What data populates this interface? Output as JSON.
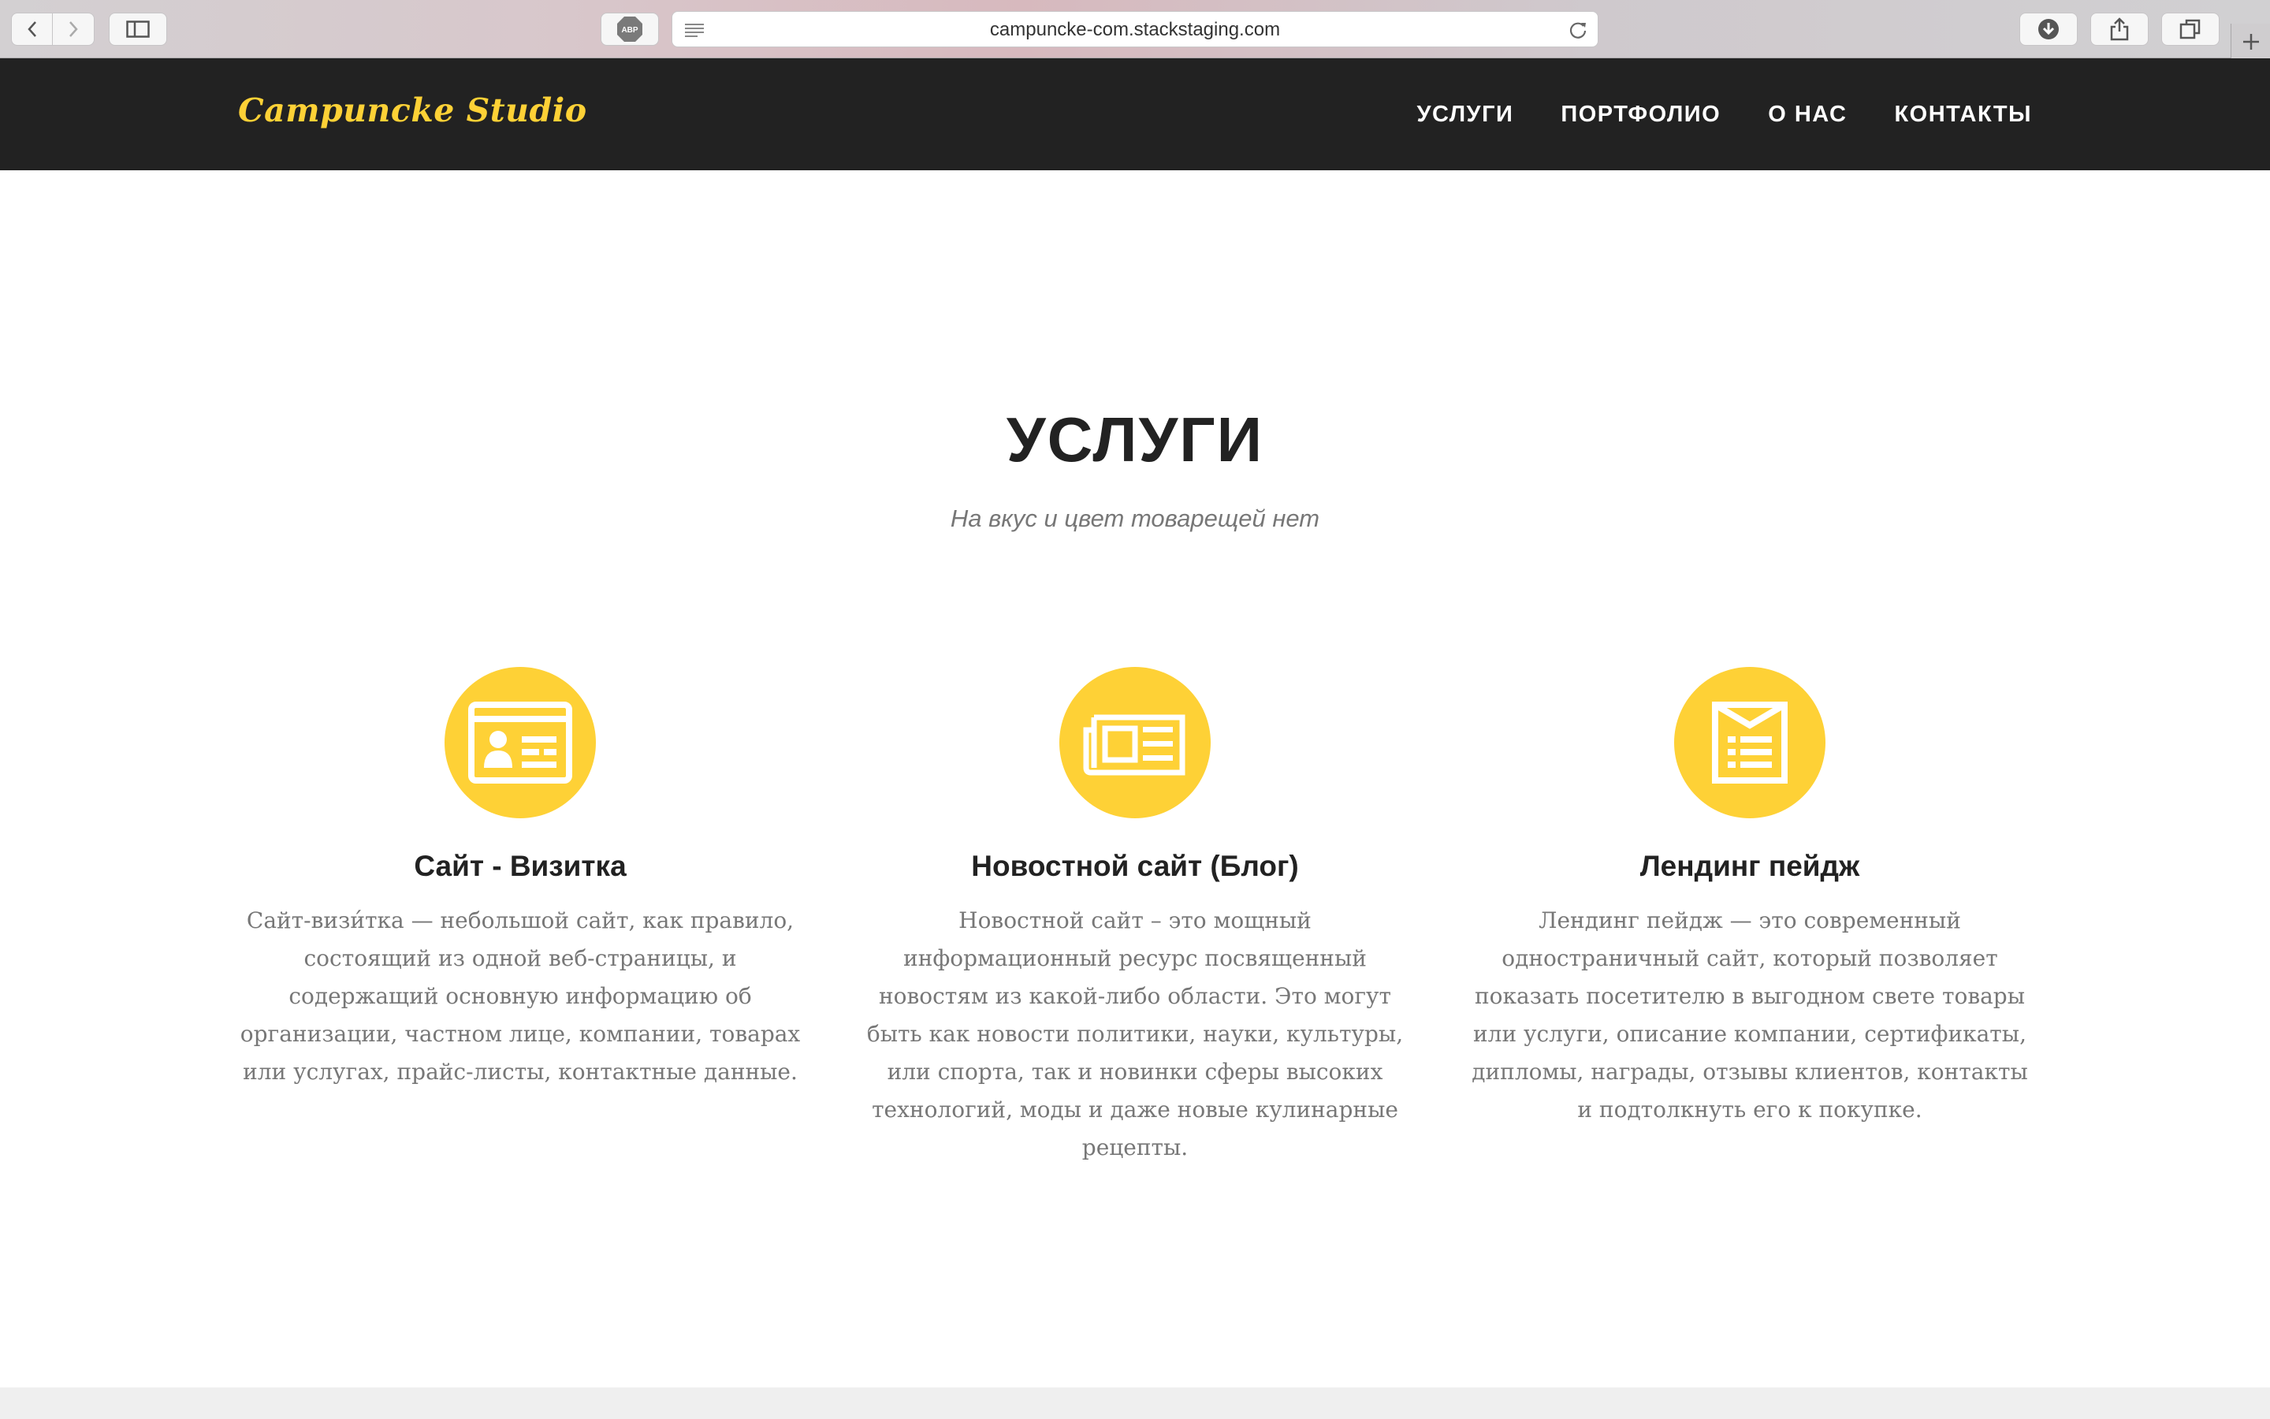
{
  "browser": {
    "url": "campuncke-com.stackstaging.com",
    "adblock_label": "ABP"
  },
  "site": {
    "logo": "Campuncke Studio",
    "menu": [
      "УСЛУГИ",
      "ПОРТФОЛИО",
      "О НАС",
      "КОНТАКТЫ"
    ]
  },
  "services": {
    "heading": "УСЛУГИ",
    "subheading": "На вкус и цвет товарещей нет",
    "items": [
      {
        "icon": "id-card-icon",
        "title": "Сайт - Визитка",
        "text": "Сайт-визи́тка — небольшой сайт, как правило, состоящий из одной веб-страницы, и содержащий основную информацию об организации, частном лице, компании, товарах или услугах, прайс-листы, контактные данные."
      },
      {
        "icon": "newspaper-icon",
        "title": "Новостной сайт (Блог)",
        "text": "Новостной сайт – это мощный информационный ресурс посвященный новостям из какой-либо области. Это могут быть как новости политики, науки, культуры, или спорта, так и новинки сферы высоких технологий, моды и даже новые кулинарные рецепты."
      },
      {
        "icon": "list-document-icon",
        "title": "Лендинг пейдж",
        "text": "Лендинг пейдж — это современный одностраничный сайт, который позволяет показать посетителю в выгодном свете товары или услуги, описание компании, сертификаты, дипломы, награды, отзывы клиентов, контакты и подтолкнуть его к покупке."
      }
    ]
  },
  "colors": {
    "accent": "#fed136",
    "header_bg": "#222222",
    "heading": "#222222",
    "muted_text": "#777777"
  }
}
